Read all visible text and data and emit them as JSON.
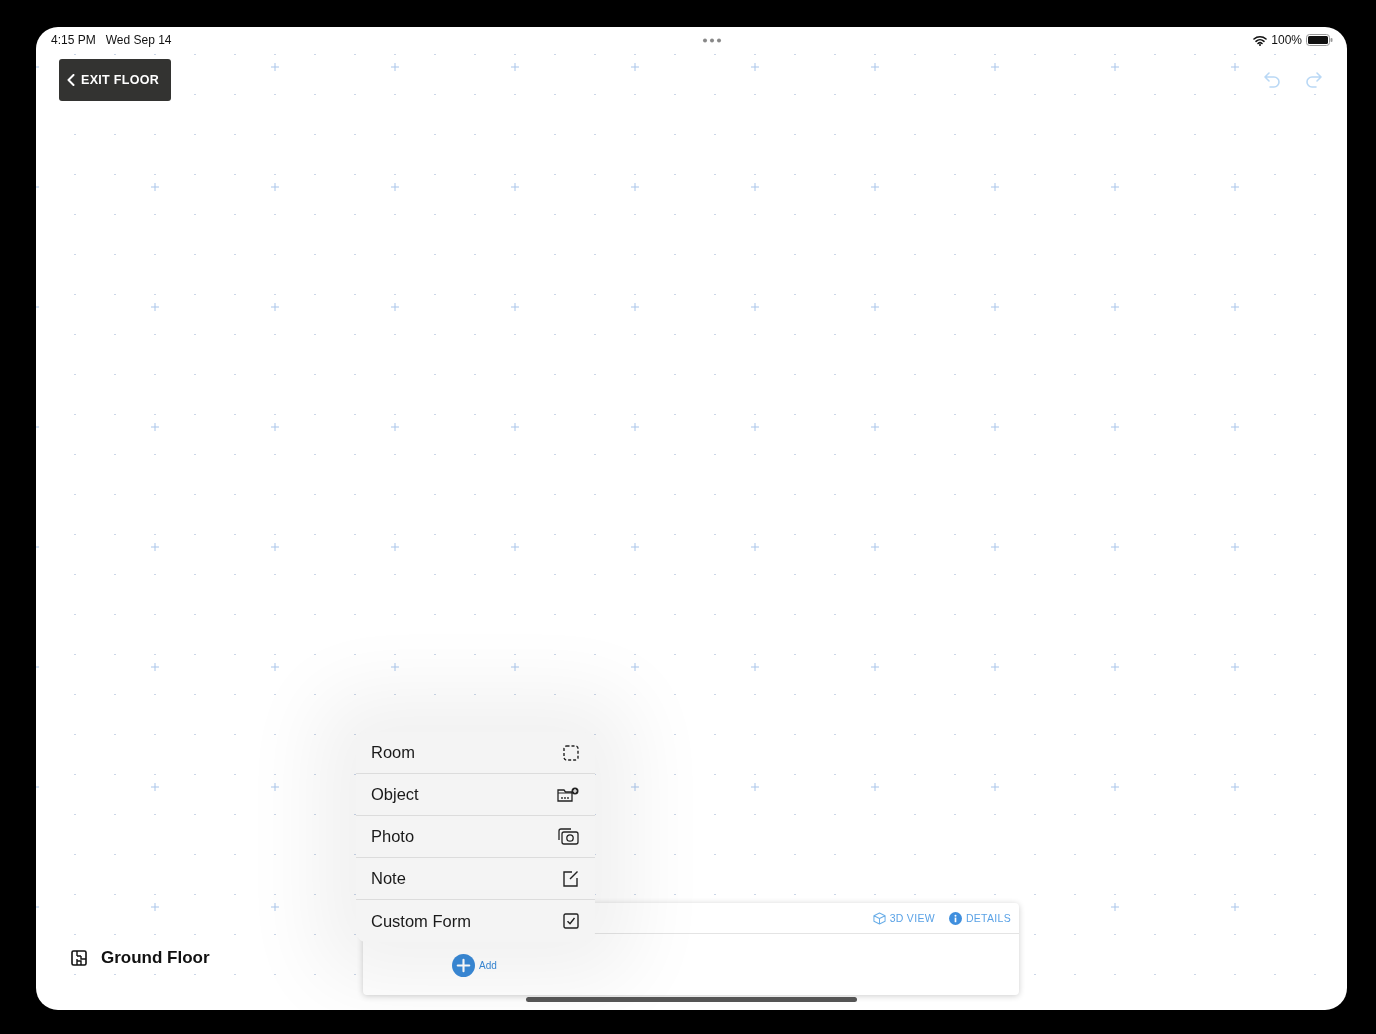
{
  "status_bar": {
    "time": "4:15 PM",
    "date": "Wed Sep 14",
    "battery": "100%"
  },
  "toolbar": {
    "exit_button": "EXIT FLOOR"
  },
  "floor": {
    "name": "Ground Floor"
  },
  "add_menu": [
    {
      "label": "Room",
      "kind": "room"
    },
    {
      "label": "Object",
      "kind": "object"
    },
    {
      "label": "Photo",
      "kind": "photo"
    },
    {
      "label": "Note",
      "kind": "note"
    },
    {
      "label": "Custom Form",
      "kind": "form"
    }
  ],
  "panel": {
    "actions": [
      {
        "label": "3D VIEW",
        "kind": "cube"
      },
      {
        "label": "DETAILS",
        "kind": "info"
      }
    ],
    "add_button": "Add"
  }
}
